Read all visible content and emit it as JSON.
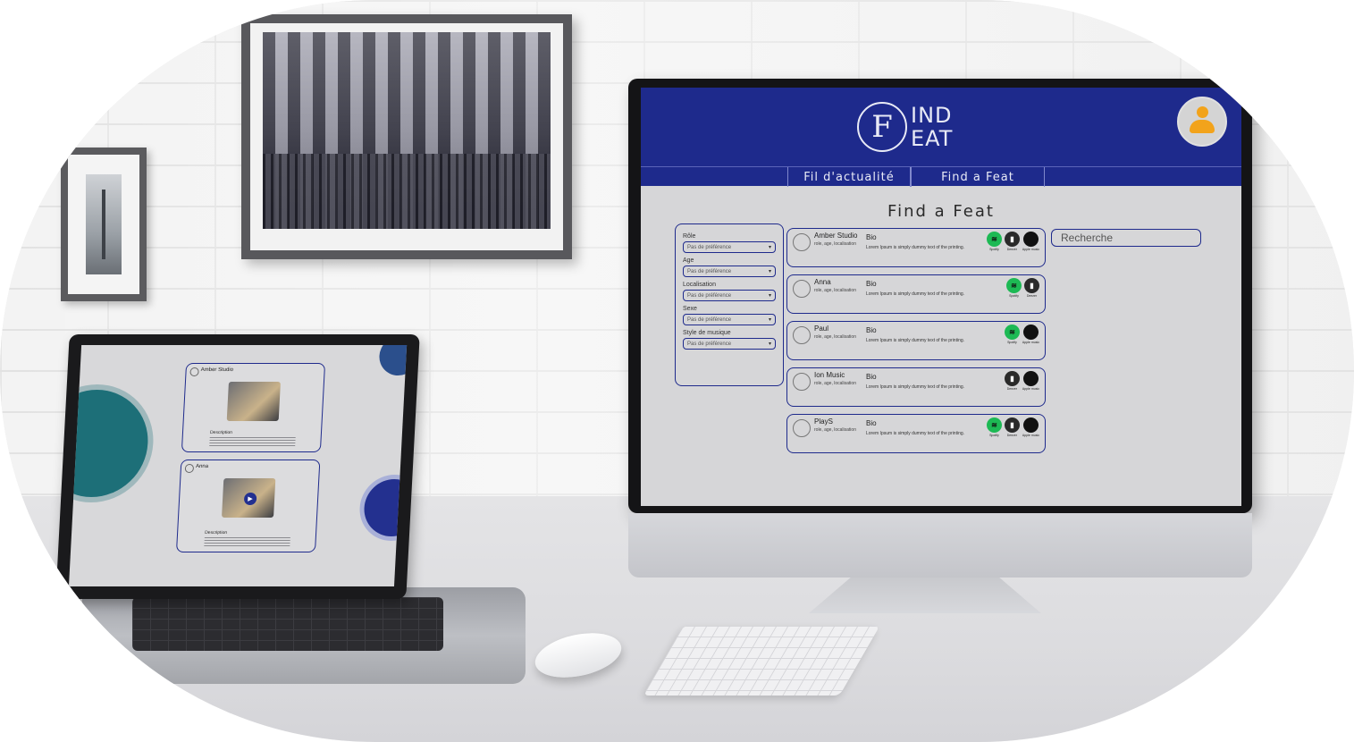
{
  "brand": {
    "logo_letter": "F",
    "logo_line1": "IND",
    "logo_line2": "EAT",
    "primary_color": "#1e2a8c",
    "avatar_color": "#f2a31b"
  },
  "nav": {
    "tabs": [
      {
        "label": "Fil d'actualité"
      },
      {
        "label": "Find a Feat"
      }
    ]
  },
  "page_title": "Find a Feat",
  "filters": [
    {
      "label": "Rôle",
      "value": "Pas de préférence"
    },
    {
      "label": "Age",
      "value": "Pas de préférence"
    },
    {
      "label": "Localisation",
      "value": "Pas de préférence"
    },
    {
      "label": "Sexe",
      "value": "Pas de préférence"
    },
    {
      "label": "Style de musique",
      "value": "Pas de préférence"
    }
  ],
  "search": {
    "placeholder": "Recherche"
  },
  "results": [
    {
      "name": "Amber Studio",
      "meta": "role, age, localisation",
      "bio_title": "Bio",
      "bio": "Lorem Ipsum is simply dummy text of the printing.",
      "services": [
        "Spotify",
        "Deezer",
        "Apple music"
      ]
    },
    {
      "name": "Anna",
      "meta": "role, age, localisation",
      "bio_title": "Bio",
      "bio": "Lorem Ipsum is simply dummy text of the printing.",
      "services": [
        "Spotify",
        "Deezer"
      ]
    },
    {
      "name": "Paul",
      "meta": "role, age, localisation",
      "bio_title": "Bio",
      "bio": "Lorem Ipsum is simply dummy text of the printing.",
      "services": [
        "Spotify",
        "Apple music"
      ]
    },
    {
      "name": "Ion Music",
      "meta": "role, age, localisation",
      "bio_title": "Bio",
      "bio": "Lorem Ipsum is simply dummy text of the printing.",
      "services": [
        "Deezer",
        "Apple music"
      ]
    },
    {
      "name": "PlayS",
      "meta": "role, age, localisation",
      "bio_title": "Bio",
      "bio": "Lorem Ipsum is simply dummy text of the printing.",
      "services": [
        "Spotify",
        "Deezer",
        "Apple music"
      ]
    }
  ],
  "laptop": {
    "posts": [
      {
        "name": "Amber Studio",
        "desc_title": "Description"
      },
      {
        "name": "Anna",
        "desc_title": "Description"
      }
    ]
  }
}
